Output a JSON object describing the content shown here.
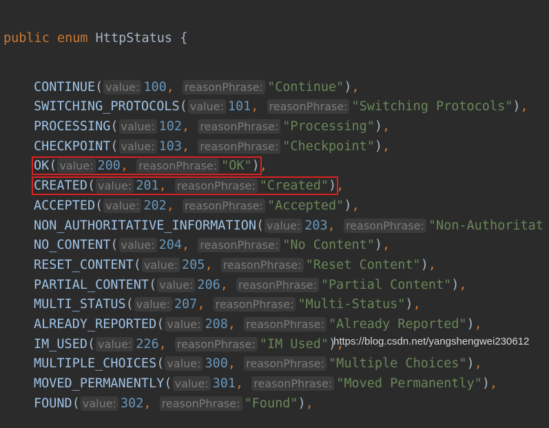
{
  "header": {
    "keyword1": "public",
    "keyword2": "enum",
    "class_name": "HttpStatus",
    "brace": "{"
  },
  "hint_labels": {
    "value": "value:",
    "reason": "reasonPhrase:"
  },
  "entries": [
    {
      "name": "CONTINUE",
      "value": "100",
      "phrase": "\"Continue\""
    },
    {
      "name": "SWITCHING_PROTOCOLS",
      "value": "101",
      "phrase": "\"Switching Protocols\""
    },
    {
      "name": "PROCESSING",
      "value": "102",
      "phrase": "\"Processing\""
    },
    {
      "name": "CHECKPOINT",
      "value": "103",
      "phrase": "\"Checkpoint\""
    },
    {
      "name": "OK",
      "value": "200",
      "phrase": "\"OK\"",
      "highlighted": true
    },
    {
      "name": "CREATED",
      "value": "201",
      "phrase": "\"Created\"",
      "highlighted": true
    },
    {
      "name": "ACCEPTED",
      "value": "202",
      "phrase": "\"Accepted\""
    },
    {
      "name": "NON_AUTHORITATIVE_INFORMATION",
      "value": "203",
      "phrase": "\"Non-Authoritat"
    },
    {
      "name": "NO_CONTENT",
      "value": "204",
      "phrase": "\"No Content\""
    },
    {
      "name": "RESET_CONTENT",
      "value": "205",
      "phrase": "\"Reset Content\""
    },
    {
      "name": "PARTIAL_CONTENT",
      "value": "206",
      "phrase": "\"Partial Content\""
    },
    {
      "name": "MULTI_STATUS",
      "value": "207",
      "phrase": "\"Multi-Status\""
    },
    {
      "name": "ALREADY_REPORTED",
      "value": "208",
      "phrase": "\"Already Reported\""
    },
    {
      "name": "IM_USED",
      "value": "226",
      "phrase": "\"IM Used\""
    },
    {
      "name": "MULTIPLE_CHOICES",
      "value": "300",
      "phrase": "\"Multiple Choices\""
    },
    {
      "name": "MOVED_PERMANENTLY",
      "value": "301",
      "phrase": "\"Moved Permanently\""
    },
    {
      "name": "FOUND",
      "value": "302",
      "phrase": "\"Found\""
    }
  ],
  "colors": {
    "background": "#2b2b2b",
    "keyword": "#cc7832",
    "number": "#6897bb",
    "string": "#6a8759",
    "highlight_box": "#e02020"
  },
  "watermark": "https://blog.csdn.net/yangshengwei230612"
}
